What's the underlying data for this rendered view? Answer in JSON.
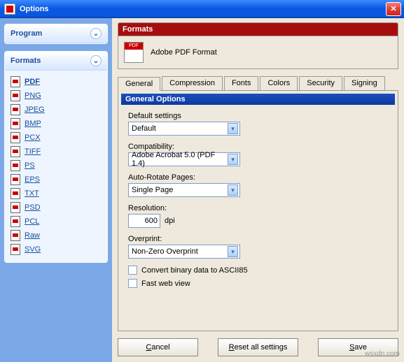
{
  "window": {
    "title": "Options"
  },
  "sidebar": {
    "program": {
      "title": "Program"
    },
    "formats": {
      "title": "Formats",
      "items": [
        {
          "label": "PDF"
        },
        {
          "label": "PNG"
        },
        {
          "label": "JPEG"
        },
        {
          "label": "BMP"
        },
        {
          "label": "PCX"
        },
        {
          "label": "TIFF"
        },
        {
          "label": "PS"
        },
        {
          "label": "EPS"
        },
        {
          "label": "TXT"
        },
        {
          "label": "PSD"
        },
        {
          "label": "PCL"
        },
        {
          "label": "Raw"
        },
        {
          "label": "SVG"
        }
      ]
    }
  },
  "header": {
    "title": "Formats",
    "format_name": "Adobe PDF Format",
    "icon_text": "PDF"
  },
  "tabs": {
    "items": [
      "General",
      "Compression",
      "Fonts",
      "Colors",
      "Security",
      "Signing"
    ],
    "active": "General"
  },
  "general": {
    "section_title": "General Options",
    "default_label": "Default settings",
    "default_value": "Default",
    "compat_label": "Compatibility:",
    "compat_value": "Adobe Acrobat 5.0 (PDF 1.4)",
    "rotate_label": "Auto-Rotate Pages:",
    "rotate_value": "Single Page",
    "resolution_label": "Resolution:",
    "resolution_value": "600",
    "resolution_unit": "dpi",
    "overprint_label": "Overprint:",
    "overprint_value": "Non-Zero Overprint",
    "chk_ascii": "Convert binary data to ASCII85",
    "chk_fastweb": "Fast web view"
  },
  "buttons": {
    "cancel": "Cancel",
    "cancel_key": "C",
    "reset": "Reset all settings",
    "reset_key": "R",
    "save": "Save",
    "save_key": "S"
  },
  "watermark": "wsxdn.com"
}
